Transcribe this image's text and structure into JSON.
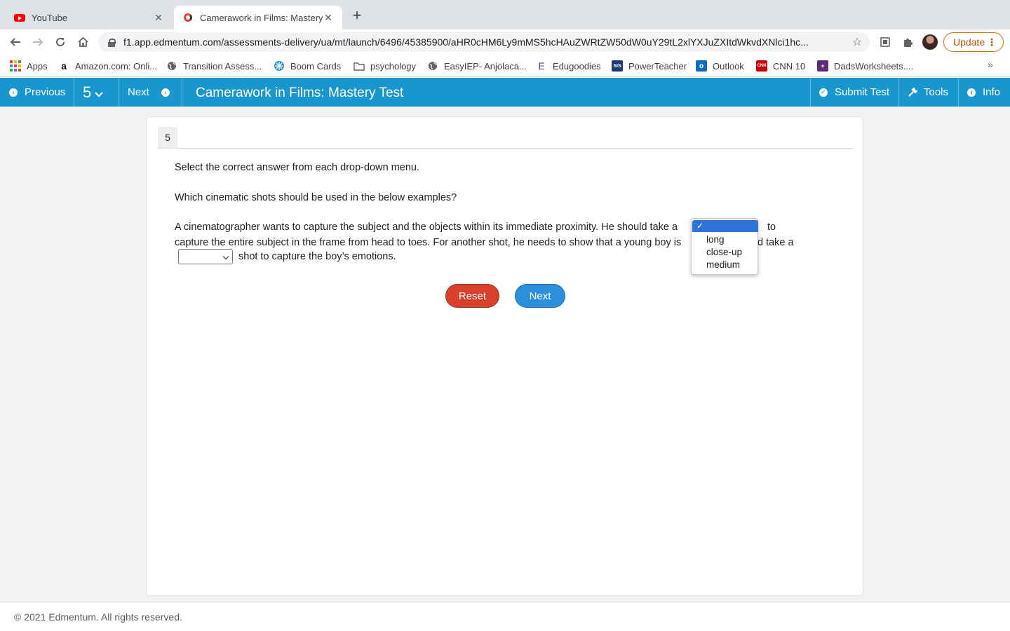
{
  "browser": {
    "tabs": [
      {
        "title": "YouTube",
        "icon": "youtube-icon",
        "active": false
      },
      {
        "title": "Camerawork in Films: Mastery",
        "icon": "edmentum-icon",
        "active": true
      }
    ],
    "url": "f1.app.edmentum.com/assessments-delivery/ua/mt/launch/6496/45385900/aHR0cHM6Ly9mMS5hcHAuZWRtZW50dW0uY29tL2xlYXJuZXItdWkvdXNlci1hc...",
    "update_label": "Update",
    "bookmarks": [
      {
        "label": "Apps",
        "icon": "apps-grid-icon"
      },
      {
        "label": "Amazon.com: Onli...",
        "icon": "amazon-icon"
      },
      {
        "label": "Transition Assess...",
        "icon": "globe-icon"
      },
      {
        "label": "Boom Cards",
        "icon": "boom-cards-icon"
      },
      {
        "label": "psychology",
        "icon": "folder-icon"
      },
      {
        "label": "EasyIEP- Anjolaca...",
        "icon": "globe-icon"
      },
      {
        "label": "Edugoodies",
        "icon": "edugoodies-icon"
      },
      {
        "label": "PowerTeacher",
        "icon": "powerteacher-icon"
      },
      {
        "label": "Outlook",
        "icon": "outlook-icon"
      },
      {
        "label": "CNN 10",
        "icon": "cnn-icon"
      },
      {
        "label": "DadsWorksheets....",
        "icon": "dadsworksheets-icon"
      }
    ]
  },
  "header": {
    "previous_label": "Previous",
    "question_number": "5",
    "next_label": "Next",
    "title": "Camerawork in Films: Mastery Test",
    "submit_label": "Submit Test",
    "tools_label": "Tools",
    "info_label": "Info",
    "accent_color": "#1a96cf"
  },
  "question": {
    "number": "5",
    "instruction": "Select the correct answer from each drop-down menu.",
    "prompt": "Which cinematic shots should be used in the below examples?",
    "line1_before": "A cinematographer wants to capture the subject and the objects within its immediate proximity. He should take a",
    "line1_after": "to",
    "line2_before": "capture the entire subject in the frame from head to toes. For another shot, he needs to show that a young boy is",
    "line2_after": "d take a",
    "line3_after": "shot to capture the boy’s emotions.",
    "dropdown_options": [
      "",
      "long",
      "close-up",
      "medium"
    ],
    "dropdown_selected": "",
    "check_mark": "✓"
  },
  "buttons": {
    "reset_label": "Reset",
    "next_label": "Next"
  },
  "footer": {
    "copyright": "© 2021 Edmentum. All rights reserved."
  }
}
